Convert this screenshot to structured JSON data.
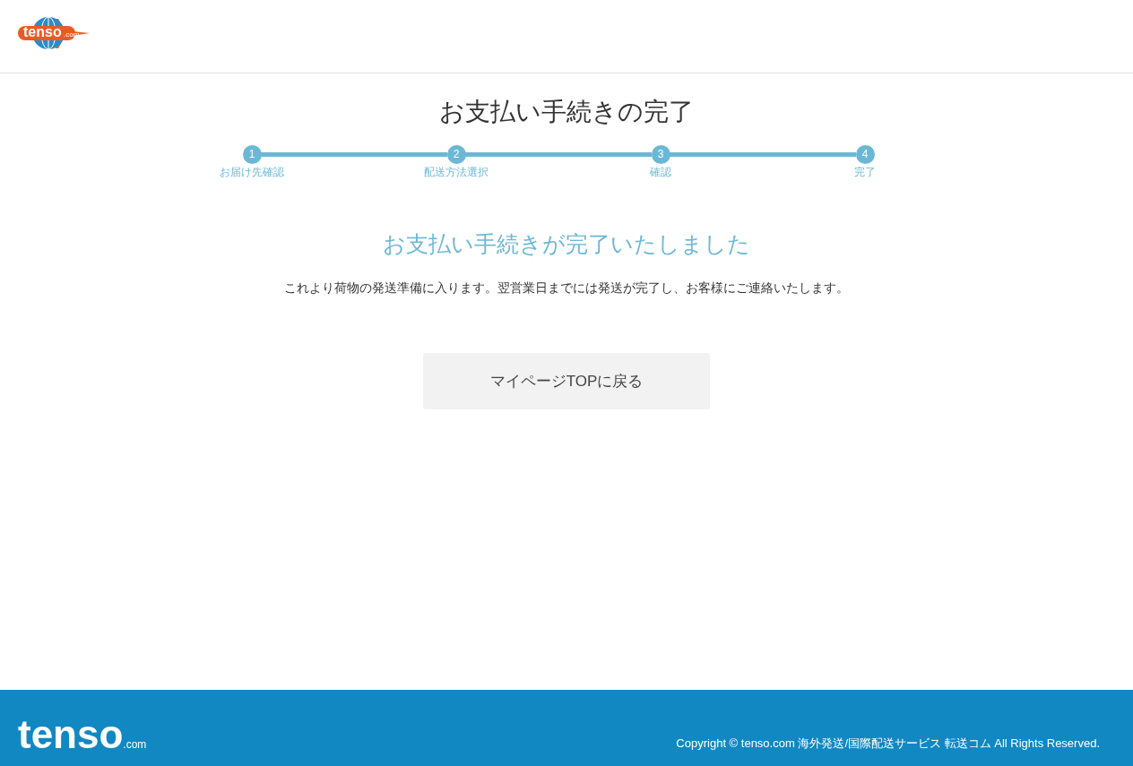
{
  "header": {
    "logo": {
      "text": "tenso",
      "suffix": ".com"
    }
  },
  "title": "お支払い手続きの完了",
  "steps": [
    {
      "number": "1",
      "label": "お届け先確認",
      "done": true
    },
    {
      "number": "2",
      "label": "配送方法選択",
      "done": true
    },
    {
      "number": "3",
      "label": "確認",
      "done": true
    },
    {
      "number": "4",
      "label": "完了",
      "done": true
    }
  ],
  "heading": "お支払い手続きが完了いたしました",
  "message": "これより荷物の発送準備に入ります。翌営業日までには発送が完了し、お客様にご連絡いたします。",
  "button": "マイページTOPに戻る",
  "footer": {
    "logo": {
      "text": "tenso",
      "suffix": ".com"
    },
    "copyright": "Copyright © tenso.com 海外発送/国際配送サービス 転送コム All Rights Reserved."
  }
}
